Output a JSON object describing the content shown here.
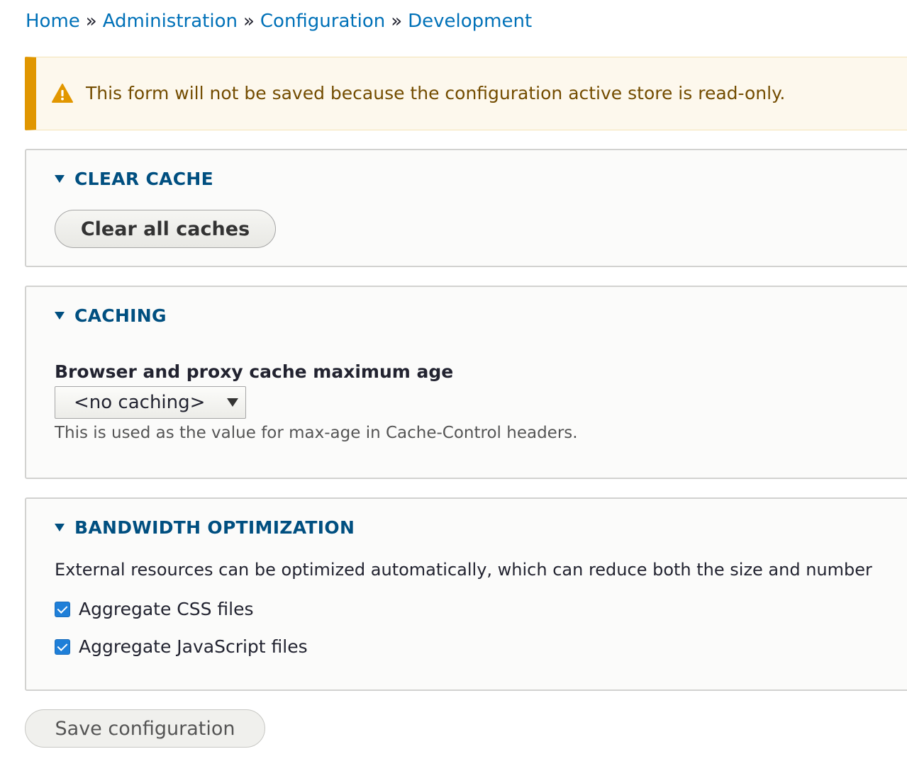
{
  "breadcrumb": {
    "items": [
      "Home",
      "Administration",
      "Configuration",
      "Development"
    ],
    "separator": "»"
  },
  "warning": {
    "icon": "warning-triangle-icon",
    "text": "This form will not be saved because the configuration active store is read-only.",
    "accent_color": "#e09600"
  },
  "clear_cache": {
    "title": "CLEAR CACHE",
    "button_label": "Clear all caches"
  },
  "caching": {
    "title": "CACHING",
    "field_label": "Browser and proxy cache maximum age",
    "select_value": "<no caching>",
    "description": "This is used as the value for max-age in Cache-Control headers."
  },
  "bandwidth": {
    "title": "BANDWIDTH OPTIMIZATION",
    "description": "External resources can be optimized automatically, which can reduce both the size and number",
    "checkboxes": [
      {
        "label": "Aggregate CSS files",
        "checked": true
      },
      {
        "label": "Aggregate JavaScript files",
        "checked": true
      }
    ]
  },
  "actions": {
    "save_label": "Save configuration"
  },
  "colors": {
    "link": "#0071b8",
    "panel_title": "#004f80",
    "warning_text": "#734c00",
    "checkbox": "#1f7fd8"
  }
}
